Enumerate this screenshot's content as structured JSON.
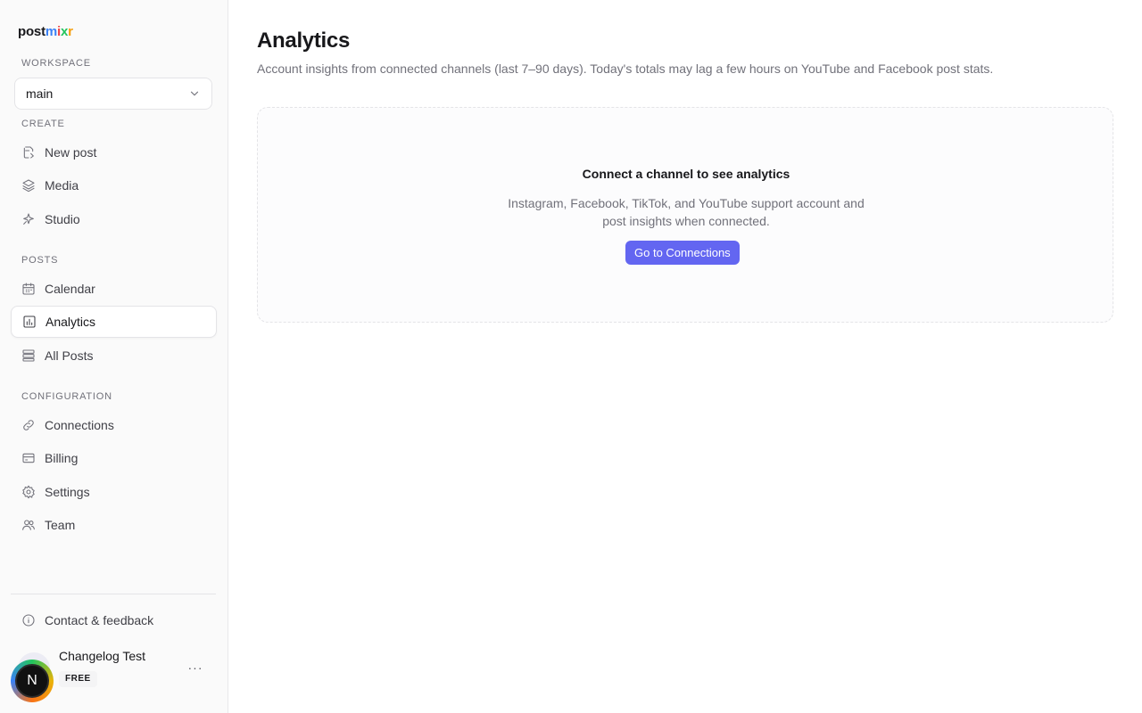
{
  "app": {
    "logo_post": "post",
    "logo_m": "m",
    "logo_i": "i",
    "logo_x": "x",
    "logo_r": "r",
    "brand_colors": {
      "m": "#3b82f6",
      "i": "#ef4444",
      "x": "#22c55e",
      "r": "#f59e0b"
    }
  },
  "sidebar": {
    "workspace_label": "WORKSPACE",
    "workspace_value": "main",
    "create_label": "CREATE",
    "posts_label": "POSTS",
    "config_label": "CONFIGURATION",
    "items": {
      "new_post": {
        "label": "New post",
        "icon": "new-post-icon"
      },
      "media": {
        "label": "Media",
        "icon": "layers-icon"
      },
      "studio": {
        "label": "Studio",
        "icon": "sparkle-icon"
      },
      "calendar": {
        "label": "Calendar",
        "icon": "calendar-icon"
      },
      "analytics": {
        "label": "Analytics",
        "icon": "bar-chart-icon",
        "active": true
      },
      "all_posts": {
        "label": "All Posts",
        "icon": "list-icon"
      },
      "connections": {
        "label": "Connections",
        "icon": "link-icon"
      },
      "billing": {
        "label": "Billing",
        "icon": "credit-card-icon"
      },
      "settings": {
        "label": "Settings",
        "icon": "gear-icon"
      },
      "team": {
        "label": "Team",
        "icon": "users-icon"
      },
      "feedback": {
        "label": "Contact & feedback",
        "icon": "info-icon"
      }
    },
    "user": {
      "name": "Changelog Test",
      "plan": "FREE",
      "avatar_initial": "N",
      "more": "···"
    }
  },
  "main": {
    "title": "Analytics",
    "description": "Account insights from connected channels (last 7–90 days). Today's totals may lag a few hours on YouTube and Facebook post stats.",
    "empty_state": {
      "title": "Connect a channel to see analytics",
      "subtitle": "Instagram, Facebook, TikTok, and YouTube support account and post insights when connected.",
      "button": "Go to Connections"
    },
    "accent": "#6366f1"
  }
}
